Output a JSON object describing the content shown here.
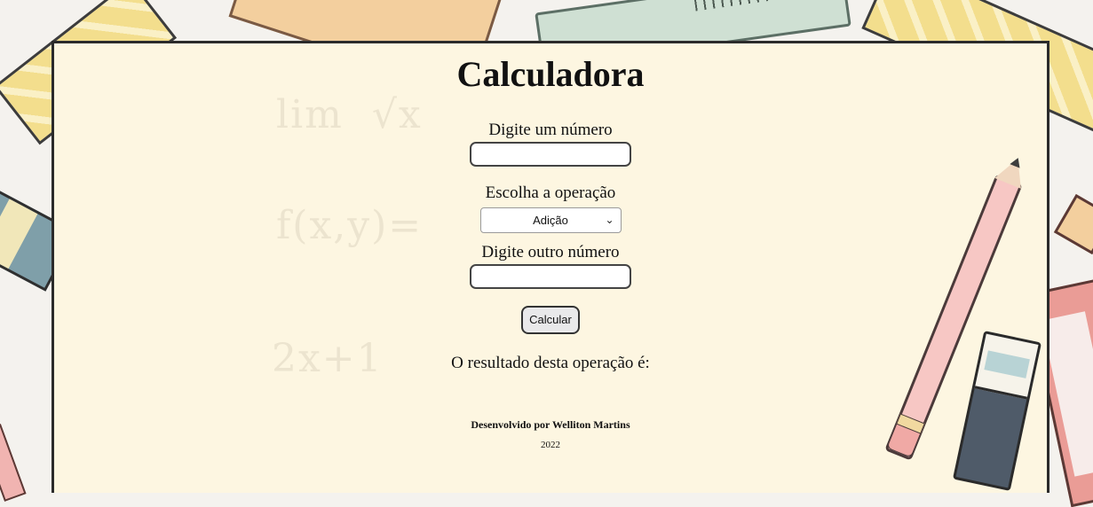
{
  "title": "Calculadora",
  "form": {
    "first_label": "Digite um número",
    "first_value": "",
    "operation_label": "Escolha a operação",
    "operation_selected": "Adição",
    "second_label": "Digite outro número",
    "second_value": "",
    "calculate_button": "Calcular"
  },
  "result_text": "O resultado desta operação é:",
  "footer": {
    "developer": "Desenvolvido por Welliton Martins",
    "year": "2022"
  },
  "icons": {
    "select_arrow": "chevron-down-icon"
  },
  "colors": {
    "paper": "#fdf6e1",
    "page_border": "#2b2b2b",
    "background": "#f4f2ee"
  }
}
